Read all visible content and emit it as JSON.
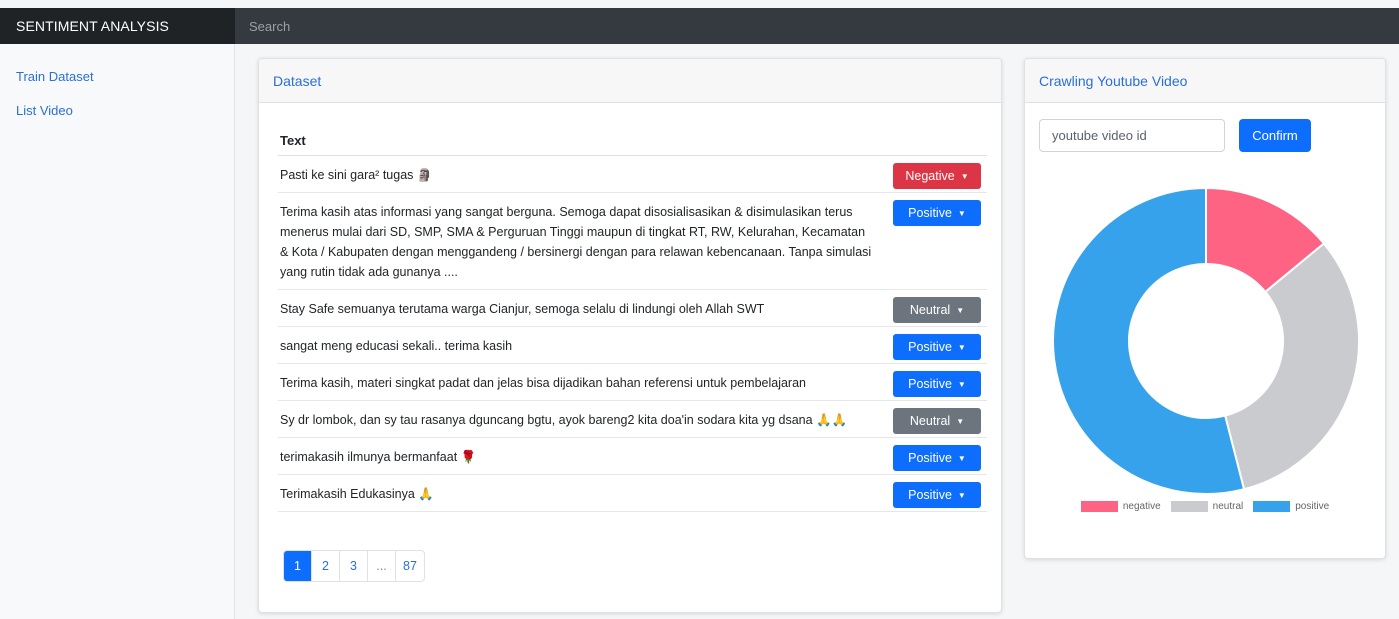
{
  "brand": "SENTIMENT ANALYSIS",
  "search": {
    "placeholder": "Search"
  },
  "sidebar": {
    "items": [
      {
        "label": "Train Dataset"
      },
      {
        "label": "List Video"
      }
    ]
  },
  "dataset": {
    "title": "Dataset",
    "column_text": "Text",
    "rows": [
      {
        "text": "Pasti ke sini gara² tugas 🗿",
        "label": "Negative",
        "color": "#dc3545"
      },
      {
        "text": "Terima kasih atas informasi yang sangat berguna. Semoga dapat disosialisasikan & disimulasikan terus menerus mulai dari SD, SMP, SMA & Perguruan Tinggi maupun di tingkat RT, RW, Kelurahan, Kecamatan & Kota / Kabupaten dengan menggandeng / bersinergi dengan para relawan kebencanaan. Tanpa simulasi yang rutin tidak ada gunanya ....",
        "label": "Positive",
        "color": "#0d6efd"
      },
      {
        "text": "Stay Safe semuanya terutama warga Cianjur, semoga selalu di lindungi oleh Allah SWT",
        "label": "Neutral",
        "color": "#6c757d"
      },
      {
        "text": "sangat meng educasi sekali.. terima kasih",
        "label": "Positive",
        "color": "#0d6efd"
      },
      {
        "text": "Terima kasih, materi singkat padat dan jelas bisa dijadikan bahan referensi untuk pembelajaran",
        "label": "Positive",
        "color": "#0d6efd"
      },
      {
        "text": "Sy dr lombok, dan sy tau rasanya dguncang bgtu, ayok bareng2 kita doa'in sodara kita yg dsana 🙏🙏",
        "label": "Neutral",
        "color": "#6c757d"
      },
      {
        "text": "terimakasih ilmunya bermanfaat 🌹",
        "label": "Positive",
        "color": "#0d6efd"
      },
      {
        "text": "Terimakasih Edukasinya 🙏",
        "label": "Positive",
        "color": "#0d6efd"
      }
    ],
    "pagination": [
      "1",
      "2",
      "3",
      "...",
      "87"
    ]
  },
  "crawl": {
    "title": "Crawling Youtube Video",
    "input_placeholder": "youtube video id",
    "confirm_label": "Confirm"
  },
  "chart_data": {
    "type": "pie",
    "variant": "doughnut",
    "categories": [
      "negative",
      "neutral",
      "positive"
    ],
    "values": [
      14,
      32,
      54
    ],
    "colors": [
      "#ff6384",
      "#c9cbcf",
      "#36a2eb"
    ],
    "legend": "bottom",
    "title": ""
  }
}
